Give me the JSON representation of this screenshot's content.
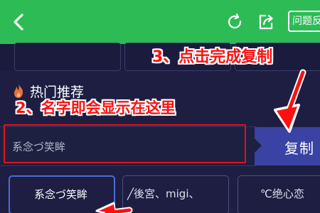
{
  "header": {
    "back_icon": "chevron-left-icon",
    "refresh_icon": "refresh-icon",
    "share_icon": "share-icon",
    "help_label": "问题反馈",
    "bg_color": "#2dbb56"
  },
  "section": {
    "icon": "flame-icon",
    "title": "热门推荐"
  },
  "name_input": {
    "value": "系念づ笑眸"
  },
  "copy_button": {
    "label": "复制",
    "color": "#3a42a4"
  },
  "suggestions": [
    {
      "label": "系念づ笑眸",
      "selected": true
    },
    {
      "label": "╱後宮、migi、"
    },
    {
      "label": "℃绝心恋"
    }
  ],
  "annotations": {
    "step3": "3、点击完成复制",
    "step2": "2、名字即会显示在这里",
    "color": "#ff1010"
  }
}
